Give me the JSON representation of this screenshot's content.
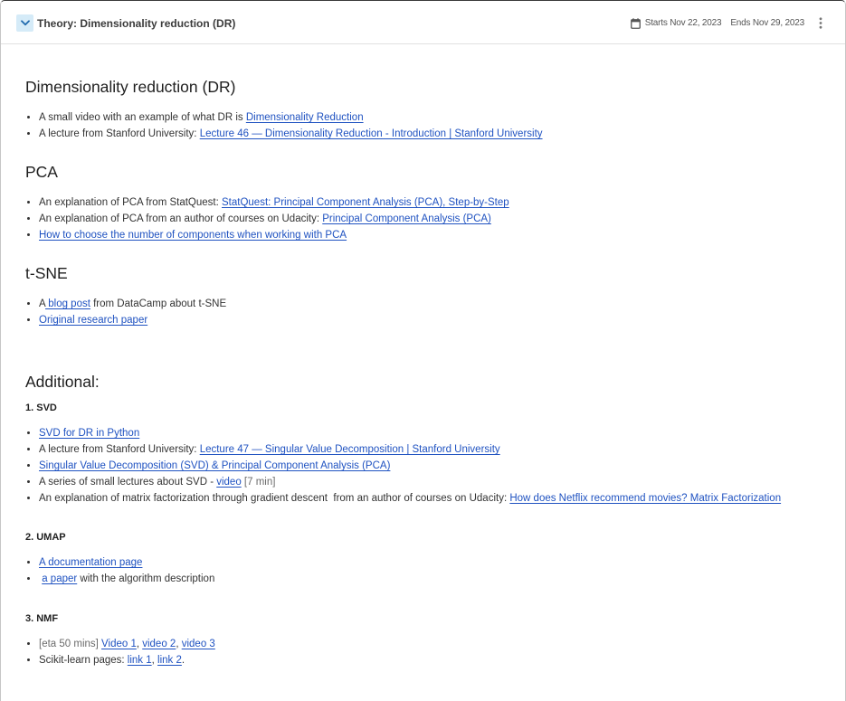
{
  "header": {
    "toggle_icon": "chevron-down-icon",
    "title": "Theory: Dimensionality reduction (DR)",
    "calendar_icon": "calendar-icon",
    "starts": "Starts Nov 22, 2023",
    "ends": "Ends Nov 29, 2023",
    "menu_icon": "more-vertical-icon"
  },
  "colors": {
    "text": "#333333",
    "heading": "#1f1f1f",
    "link": "#1f52c1",
    "muted": "#6b6b6b",
    "toggle_background": "#d5ebf8",
    "toggle_icon": "#1f6aae"
  },
  "sections": [
    {
      "heading": "Dimensionality reduction (DR)",
      "items": [
        [
          {
            "text": "A small video with an example of what DR is "
          },
          {
            "link": "Dimensionality Reduction"
          }
        ],
        [
          {
            "text": "A lecture from Stanford University: "
          },
          {
            "link": "Lecture 46 — Dimensionality Reduction - Introduction | Stanford University"
          }
        ]
      ]
    },
    {
      "heading": "PCA",
      "items": [
        [
          {
            "text": "An explanation of PCA from StatQuest: "
          },
          {
            "link": "StatQuest: Principal Component Analysis (PCA), Step-by-Step"
          }
        ],
        [
          {
            "text": "An explanation of PCA from an author of courses on Udacity: "
          },
          {
            "link": "Principal Component Analysis (PCA)"
          }
        ],
        [
          {
            "link": "How to choose the number of components when working with PCA"
          }
        ]
      ]
    },
    {
      "heading": "t-SNE",
      "items": [
        [
          {
            "text": "A"
          },
          {
            "link": " blog post"
          },
          {
            "text": " from DataCamp about t-SNE"
          }
        ],
        [
          {
            "link": "Original research paper"
          }
        ]
      ]
    }
  ],
  "additional": {
    "heading": "Additional:",
    "subsections": [
      {
        "heading": "1. SVD",
        "items": [
          [
            {
              "link": "SVD for DR in Python"
            }
          ],
          [
            {
              "text": "A lecture from Stanford University: "
            },
            {
              "link": "Lecture 47 — Singular Value Decomposition | Stanford University"
            }
          ],
          [
            {
              "link": "Singular Value Decomposition (SVD) & Principal Component Analysis (PCA)"
            }
          ],
          [
            {
              "text": "A series of small lectures about SVD - "
            },
            {
              "link": "video"
            },
            {
              "text": " "
            },
            {
              "note": "[7 min]"
            }
          ],
          [
            {
              "text": "An explanation of matrix factorization through gradient descent  from an author of courses on Udacity: "
            },
            {
              "link": "How does Netflix recommend movies? Matrix Factorization"
            }
          ]
        ]
      },
      {
        "heading": "2. UMAP",
        "items": [
          [
            {
              "link": "A documentation page"
            }
          ],
          [
            {
              "text": " "
            },
            {
              "link": "a paper"
            },
            {
              "text": " with the algorithm description"
            }
          ]
        ]
      },
      {
        "heading": "3. NMF",
        "items": [
          [
            {
              "note": "[eta 50 mins]"
            },
            {
              "text": " "
            },
            {
              "link": "Video 1"
            },
            {
              "text": ", "
            },
            {
              "link": "video 2"
            },
            {
              "text": ", "
            },
            {
              "link": "video 3"
            }
          ],
          [
            {
              "text": "Scikit-learn pages: "
            },
            {
              "link": "link 1"
            },
            {
              "text": ", "
            },
            {
              "link": "link 2"
            },
            {
              "text": "."
            }
          ]
        ]
      }
    ]
  }
}
